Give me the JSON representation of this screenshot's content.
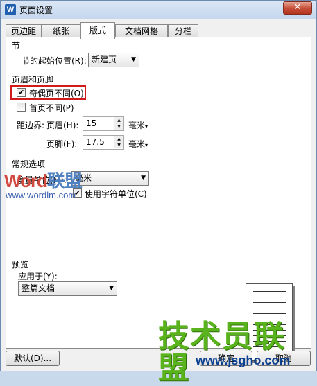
{
  "window": {
    "title": "页面设置",
    "app_icon": "W",
    "close_glyph": "✕"
  },
  "tabs": [
    {
      "label": "页边距"
    },
    {
      "label": "纸张"
    },
    {
      "label": "版式"
    },
    {
      "label": "文档网格"
    },
    {
      "label": "分栏"
    }
  ],
  "section": {
    "title": "节",
    "start_label": "节的起始位置(R):",
    "start_value": "新建页"
  },
  "header_footer": {
    "title": "页眉和页脚",
    "odd_even": {
      "label": "奇偶页不同(O)",
      "checked": true
    },
    "first_page": {
      "label": "首页不同(P)",
      "checked": false
    },
    "distance_label": "距边界:",
    "header_label": "页眉(H):",
    "header_value": "15",
    "footer_label": "页脚(F):",
    "footer_value": "17.5",
    "unit": "毫米"
  },
  "general": {
    "title": "常规选项",
    "measure_label": "度量单位(M):",
    "measure_value": "毫米",
    "char_unit": {
      "label": "使用字符单位(C)",
      "checked": true
    }
  },
  "preview": {
    "title": "预览",
    "apply_label": "应用于(Y):",
    "apply_value": "整篇文档"
  },
  "buttons": {
    "default": "默认(D)...",
    "ok": "确定",
    "cancel": "取消"
  },
  "watermarks": {
    "wordlm_a": "Word",
    "wordlm_b": "联盟",
    "wordlm_url": "www.wordlm.com",
    "jsgho": "技术员联盟",
    "jsgho_url": "www.jsgho.com"
  },
  "colors": {
    "highlight": "#d11a1a",
    "titlebar": "#c5d7ee",
    "close": "#c7503a"
  }
}
